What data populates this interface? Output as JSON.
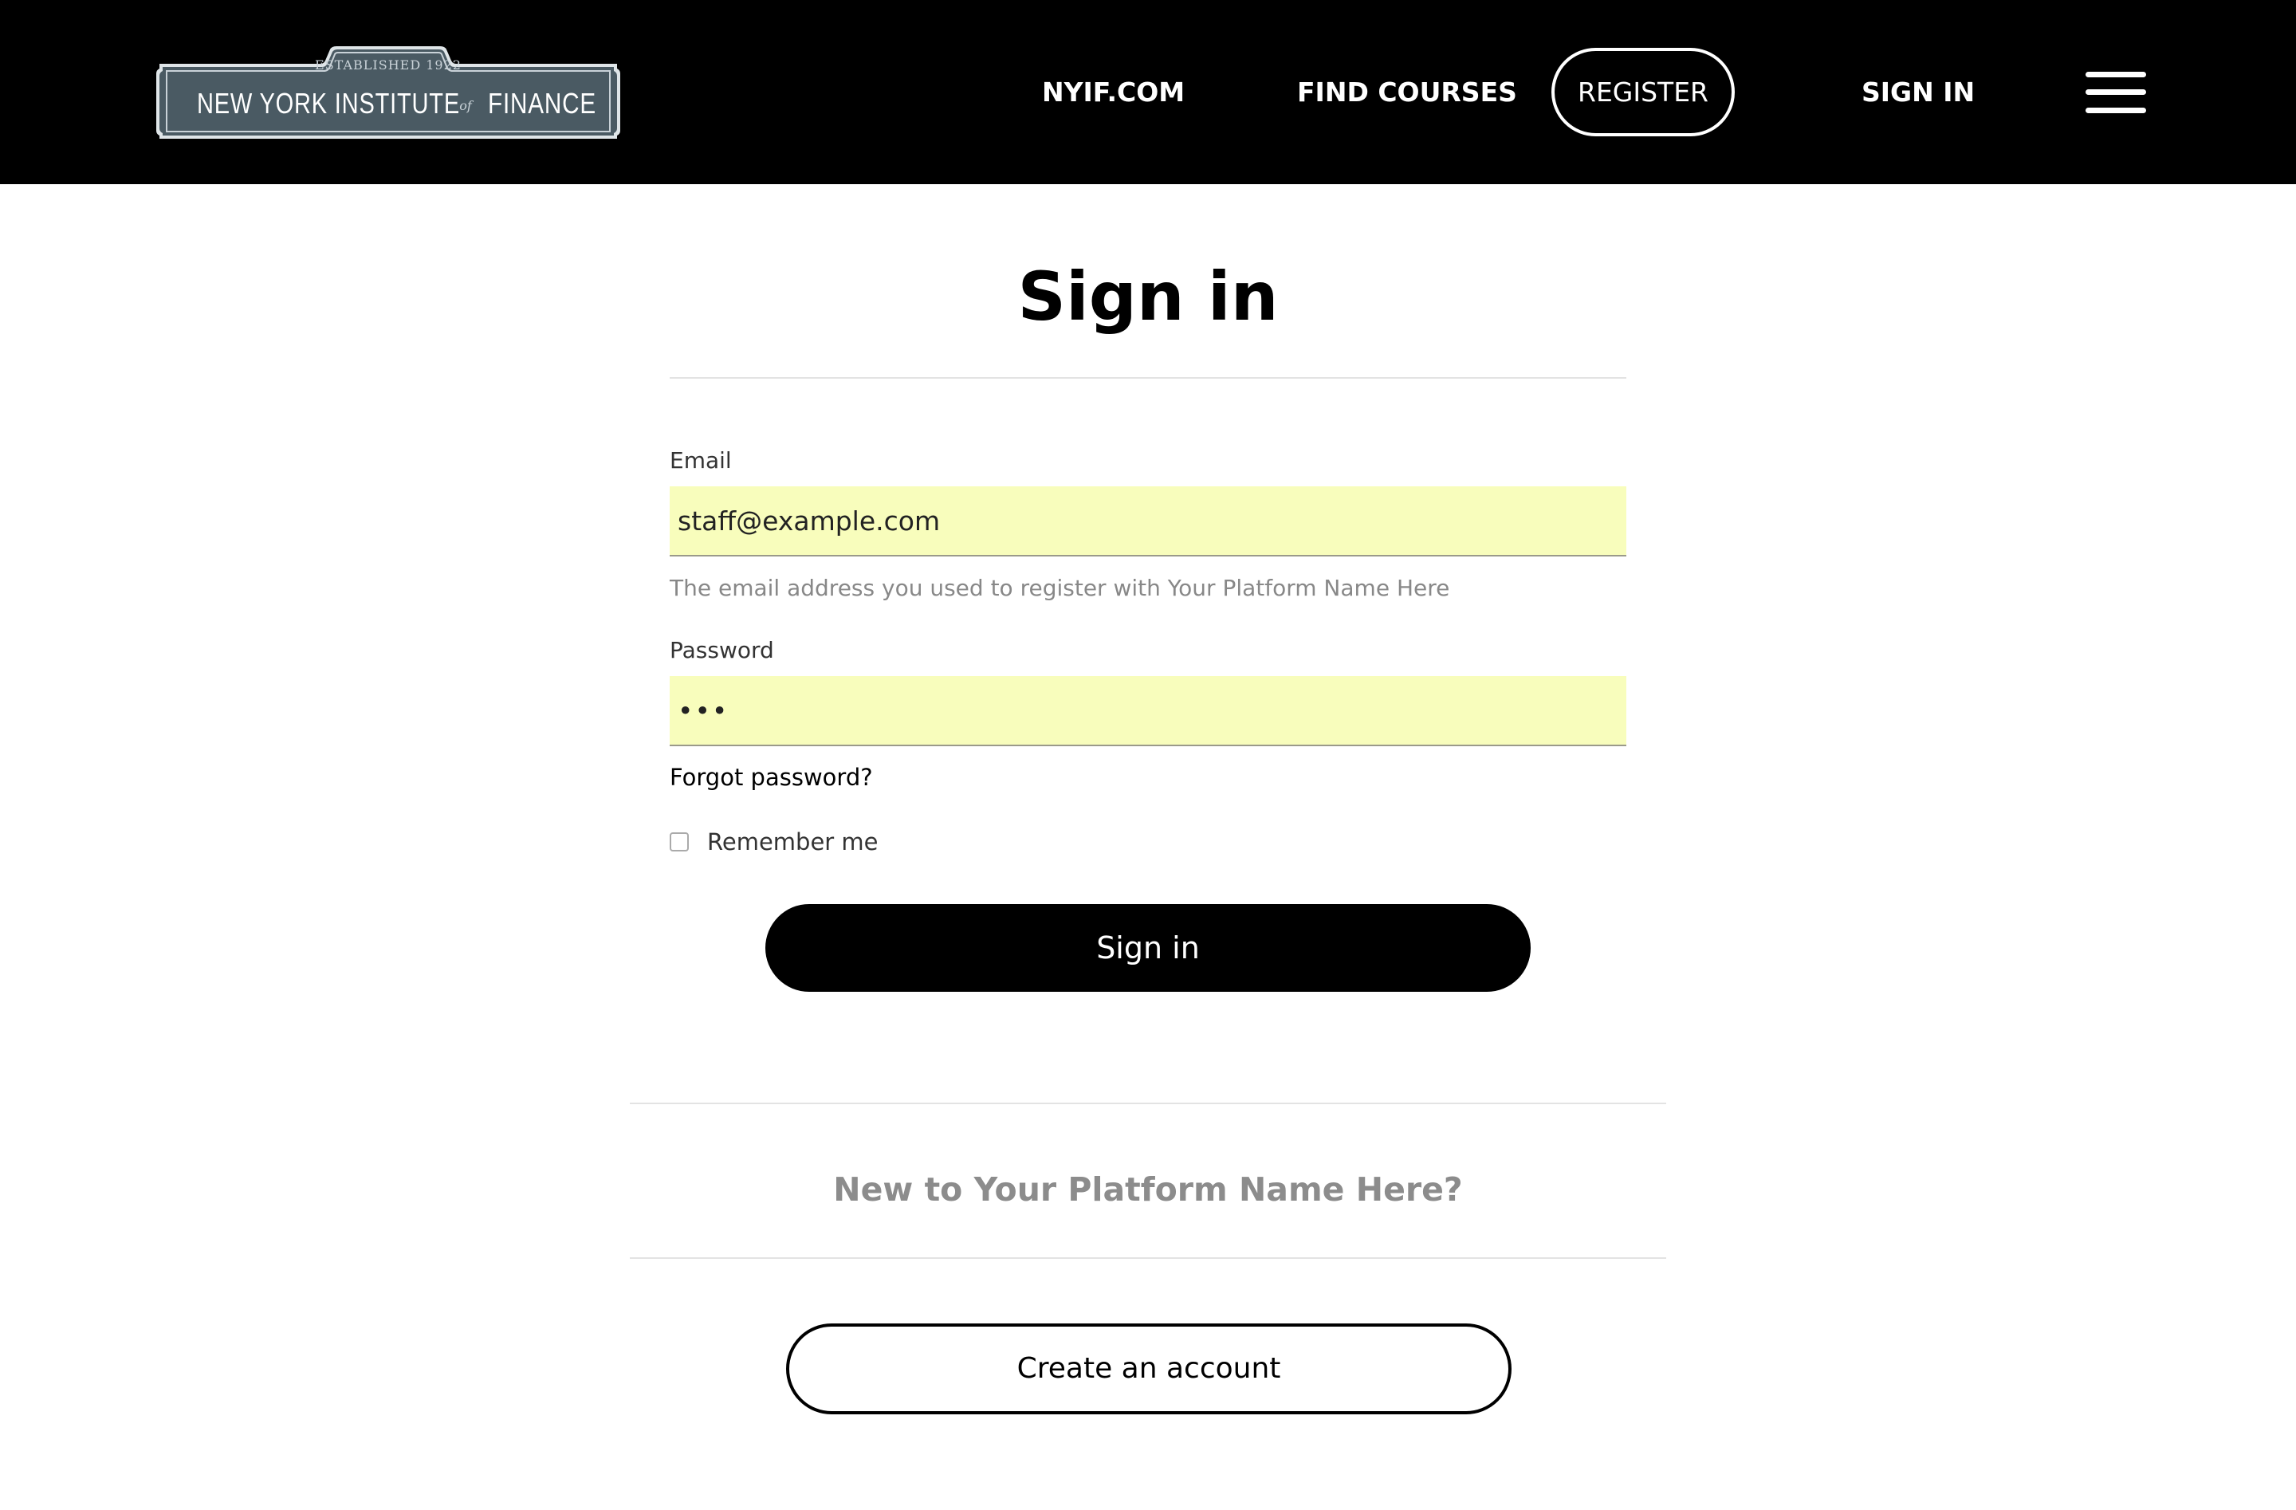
{
  "header": {
    "logo": {
      "established": "ESTABLISHED 1922",
      "left_text": "NEW YORK INSTITUTE",
      "of_text": "of",
      "right_text": "FINANCE",
      "plate_color": "#4a5a63",
      "accent_color": "#c9d2d8"
    },
    "nav": {
      "nyif": "NYIF.COM",
      "find_courses": "FIND COURSES",
      "register": "REGISTER",
      "sign_in": "SIGN IN"
    },
    "menu_icon": "hamburger-menu-icon"
  },
  "form": {
    "title": "Sign in",
    "email": {
      "label": "Email",
      "value": "staff@example.com",
      "help": "The email address you used to register with Your Platform Name Here"
    },
    "password": {
      "label": "Password",
      "value": "•••"
    },
    "forgot": "Forgot password?",
    "remember": {
      "label": "Remember me",
      "checked": false
    },
    "submit": "Sign in"
  },
  "register_section": {
    "heading": "New to Your Platform Name Here?",
    "button": "Create an account"
  },
  "colors": {
    "header_bg": "#000000",
    "input_autofill_bg": "#f8fdbc",
    "muted_text": "#8c8c8c"
  }
}
